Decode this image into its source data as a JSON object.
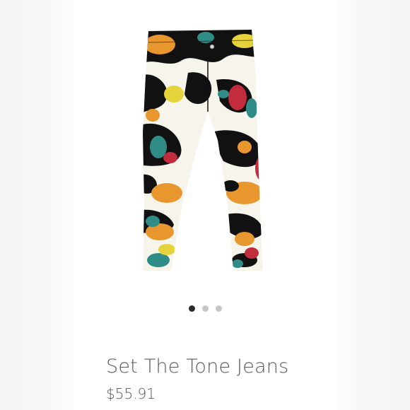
{
  "product": {
    "title": "Set The Tone Jeans",
    "price": "$55.91",
    "image_icon": "jeans-product-photo",
    "colors": {
      "print_black": "#111111",
      "print_orange": "#e8962e",
      "print_teal": "#2f8c86",
      "print_red": "#c22c3c",
      "print_yellow": "#e6d23a",
      "print_white": "#f7f4ec"
    }
  },
  "carousel": {
    "slide_count": 3,
    "active_index": 0
  },
  "theme": {
    "title_color": "#5a5a5a",
    "dot_active": "#2a2a2a",
    "dot_inactive": "#c6c6c6"
  }
}
